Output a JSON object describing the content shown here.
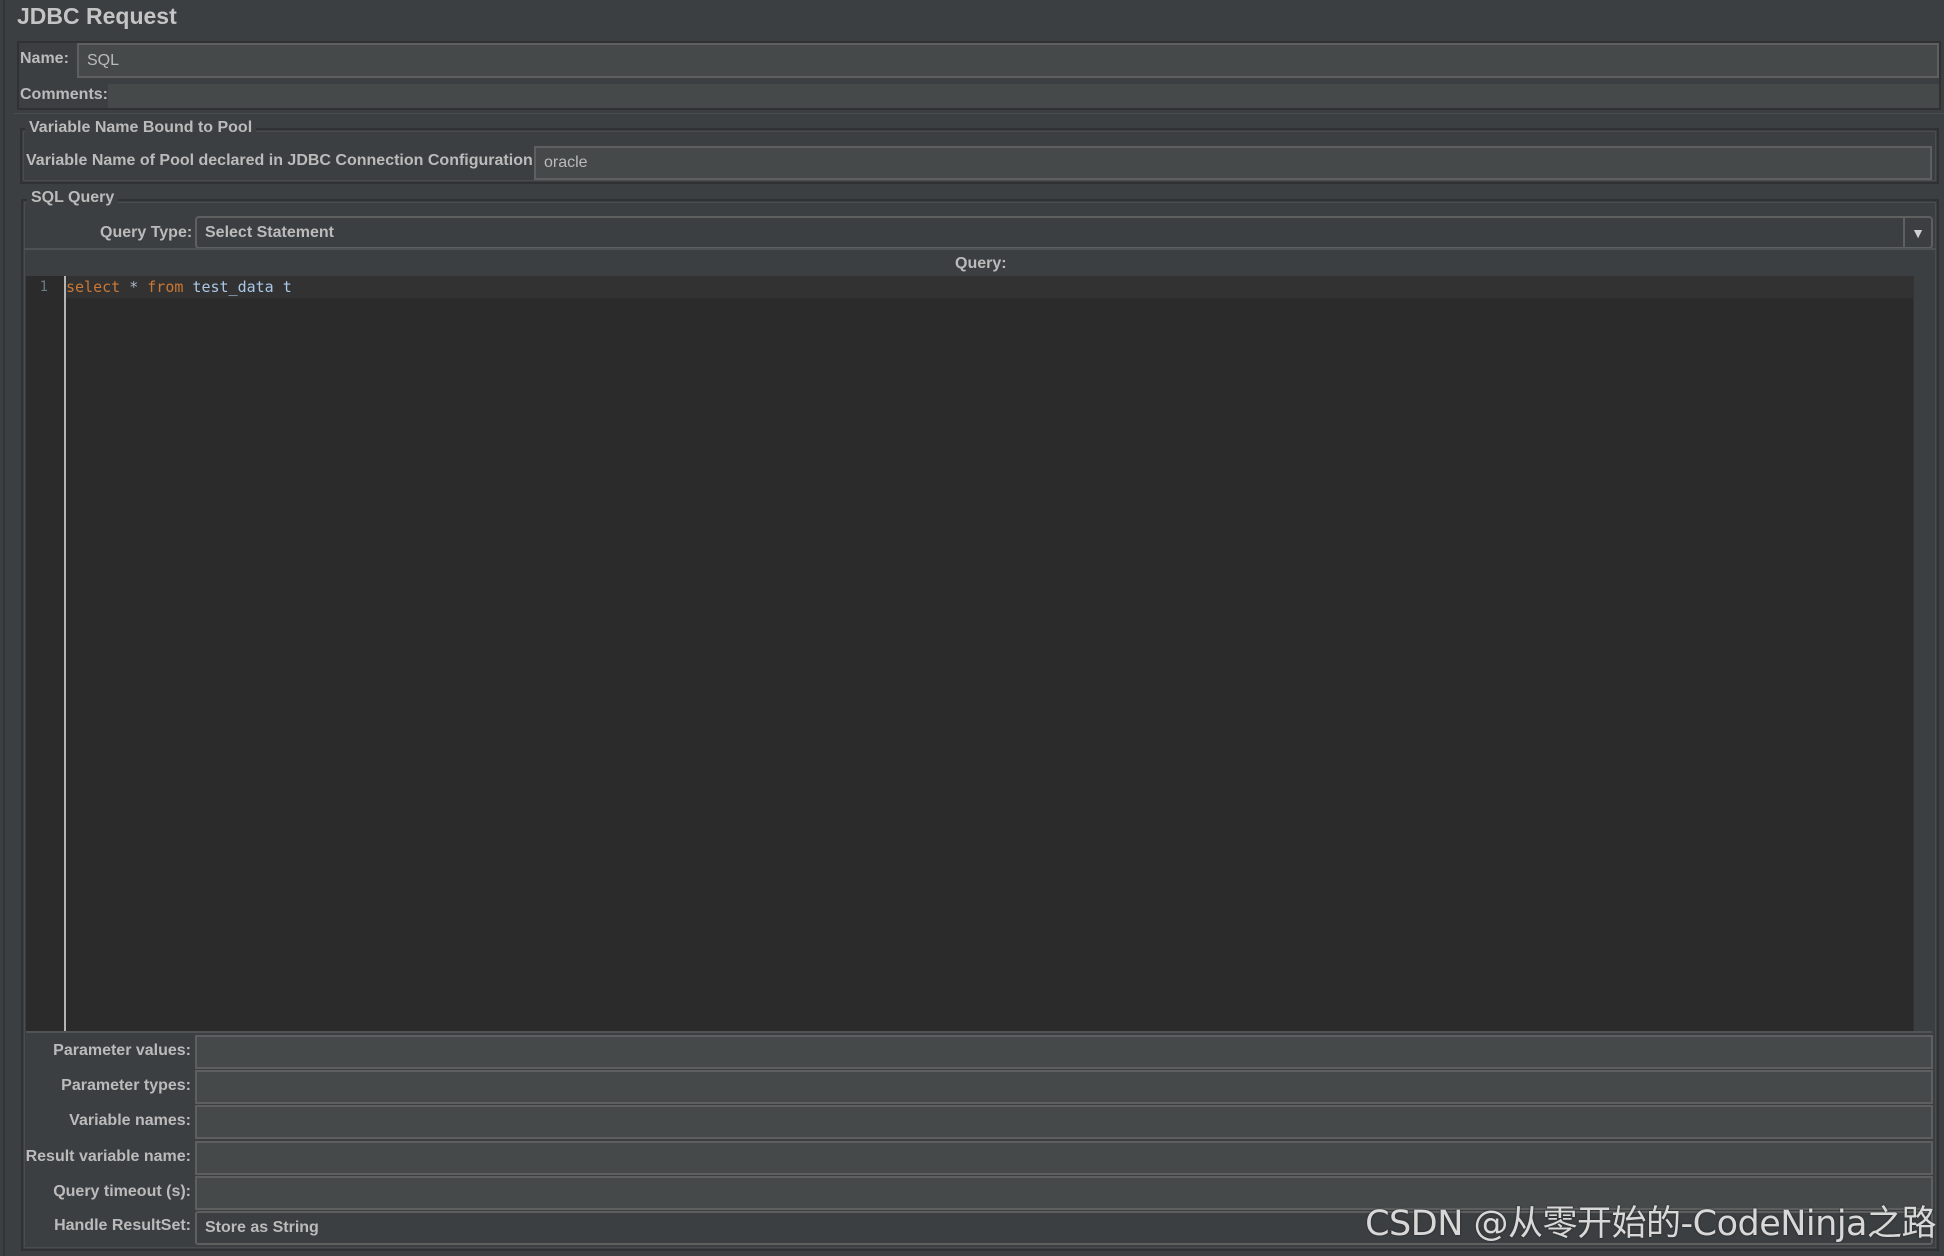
{
  "title": "JDBC Request",
  "name_label": "Name:",
  "name_value": "SQL",
  "comments_label": "Comments:",
  "comments_value": "",
  "pool_group": {
    "legend": "Variable Name Bound to Pool",
    "label": "Variable Name of Pool declared in JDBC Connection Configuration:",
    "value": "oracle"
  },
  "sql_group": {
    "legend": "SQL Query",
    "query_type_label": "Query Type:",
    "query_type_value": "Select Statement",
    "query_label": "Query:",
    "editor": {
      "line_numbers": [
        "1"
      ],
      "tokens": [
        {
          "text": "select",
          "kind": "keyword"
        },
        {
          "text": " * ",
          "kind": "operator"
        },
        {
          "text": "from",
          "kind": "keyword"
        },
        {
          "text": " test_data t",
          "kind": "identifier"
        }
      ]
    },
    "params": [
      {
        "label": "Parameter values:",
        "value": ""
      },
      {
        "label": "Parameter types:",
        "value": ""
      },
      {
        "label": "Variable names:",
        "value": ""
      },
      {
        "label": "Result variable name:",
        "value": ""
      },
      {
        "label": "Query timeout (s):",
        "value": ""
      }
    ],
    "handle_resultset_label": "Handle ResultSet:",
    "handle_resultset_value": "Store as String"
  },
  "watermark": "CSDN @从零开始的-CodeNinja之路",
  "icons": {
    "dropdown_arrow": "▼"
  },
  "colors": {
    "keyword": "#cc7832",
    "identifier": "#a9c7e6",
    "background": "#3c3f41",
    "editor_bg": "#2b2b2b"
  }
}
